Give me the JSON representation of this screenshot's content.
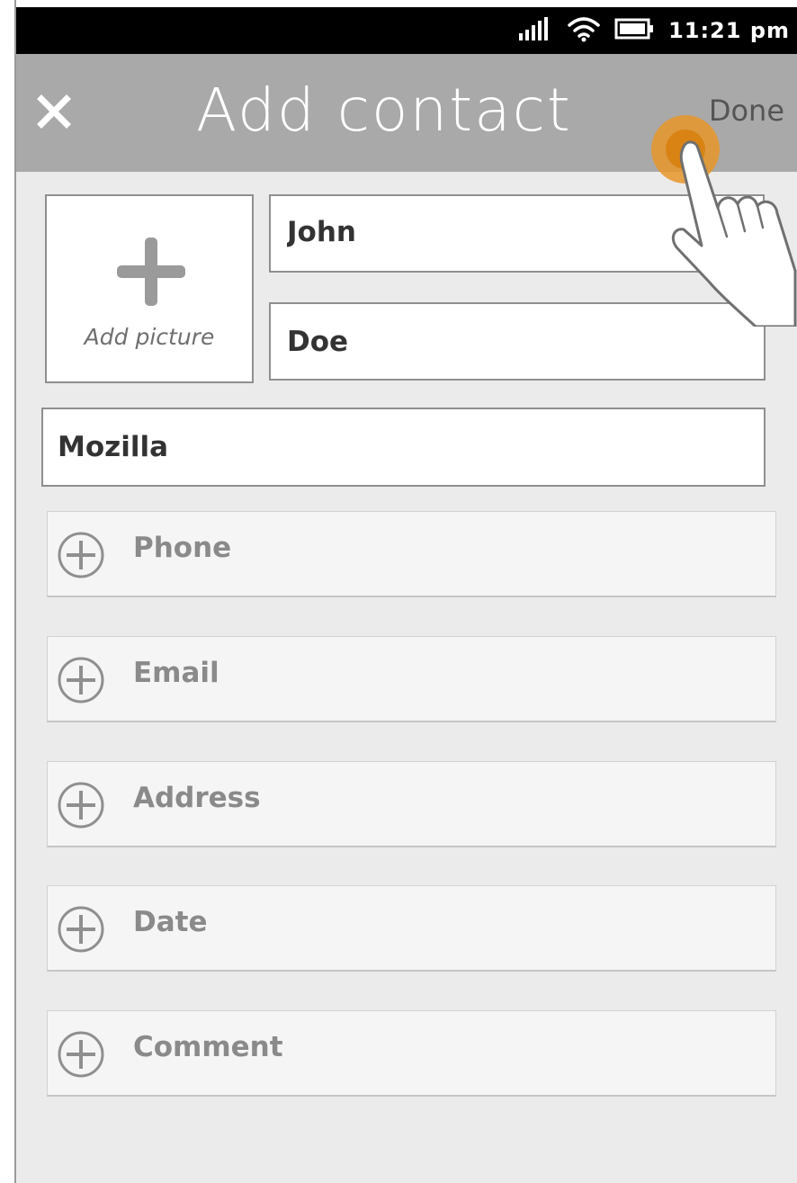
{
  "status_bar": {
    "time": "11:21 pm",
    "icons": [
      "signal-icon",
      "wifi-icon",
      "battery-icon"
    ]
  },
  "header": {
    "close_icon": "close-icon",
    "title": "Add contact",
    "done_label": "Done"
  },
  "picture": {
    "label": "Add picture",
    "icon": "plus-icon"
  },
  "fields": {
    "first_name": "John",
    "last_name": "Doe",
    "company": "Mozilla"
  },
  "add_rows": [
    {
      "label": "Phone"
    },
    {
      "label": "Email"
    },
    {
      "label": "Address"
    },
    {
      "label": "Date"
    },
    {
      "label": "Comment"
    }
  ],
  "colors": {
    "status_bar": "#000000",
    "header": "#a9a9a9",
    "background": "#ebebeb",
    "touch_indicator": "#e8962a"
  }
}
